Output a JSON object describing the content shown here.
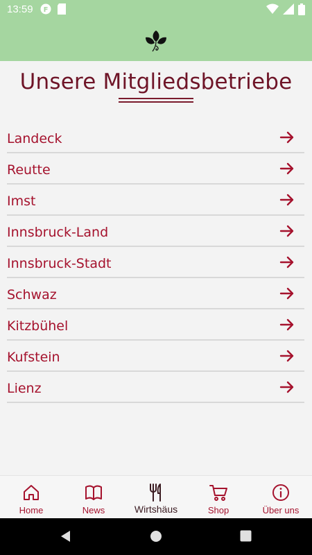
{
  "status_bar": {
    "time": "13:59",
    "icons_left": [
      "f-notification-icon",
      "sd-card-icon"
    ],
    "icons_right": [
      "wifi-icon",
      "signal-icon",
      "battery-icon"
    ]
  },
  "app_bar": {
    "logo": "leaf-logo-icon",
    "color": "#a5d6a0"
  },
  "page": {
    "title": "Unsere Mitgliedsbetriebe"
  },
  "regions": [
    {
      "label": "Landeck"
    },
    {
      "label": "Reutte"
    },
    {
      "label": "Imst"
    },
    {
      "label": "Innsbruck-Land"
    },
    {
      "label": "Innsbruck-Stadt"
    },
    {
      "label": "Schwaz"
    },
    {
      "label": "Kitzbühel"
    },
    {
      "label": "Kufstein"
    },
    {
      "label": "Lienz"
    }
  ],
  "bottom_nav": {
    "items": [
      {
        "label": "Home",
        "icon": "home-icon"
      },
      {
        "label": "News",
        "icon": "book-icon"
      },
      {
        "label": "Wirtshäus",
        "icon": "fork-knife-icon",
        "active": true
      },
      {
        "label": "Shop",
        "icon": "cart-icon"
      },
      {
        "label": "Über uns",
        "icon": "info-icon"
      }
    ]
  },
  "colors": {
    "accent": "#a5122d",
    "title": "#6e1427",
    "header": "#a5d6a0",
    "background": "#f3f3f3"
  }
}
